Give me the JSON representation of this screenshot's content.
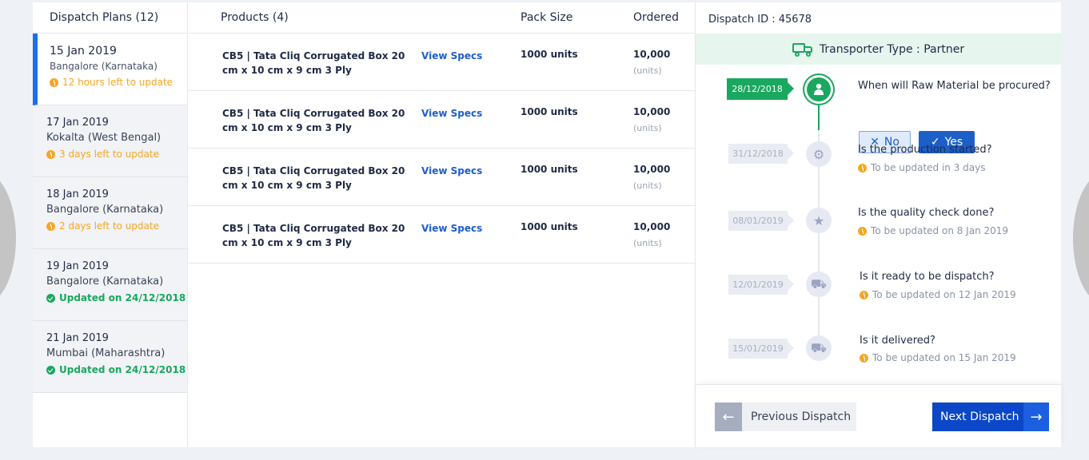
{
  "plans": {
    "header": "Dispatch Plans (12)",
    "items": [
      {
        "date": "15 Jan 2019",
        "location": "Bangalore (Karnataka)",
        "status": "12 hours left to update",
        "state": "warn"
      },
      {
        "date": "17 Jan 2019",
        "location": "Kokalta (West Bengal)",
        "status": "3 days left to update",
        "state": "warn"
      },
      {
        "date": "18 Jan 2019",
        "location": "Bangalore (Karnataka)",
        "status": "2 days left to update",
        "state": "warn"
      },
      {
        "date": "19 Jan 2019",
        "location": "Bangalore (Karnataka)",
        "status": "Updated on 24/12/2018",
        "state": "ok"
      },
      {
        "date": "21 Jan 2019",
        "location": "Mumbai (Maharashtra)",
        "status": "Updated on 24/12/2018",
        "state": "ok"
      }
    ]
  },
  "products": {
    "headers": {
      "product": "Products (4)",
      "pack": "Pack Size",
      "ordered": "Ordered"
    },
    "rows": [
      {
        "name": "CB5 | Tata Cliq Corrugated Box 20 cm x 10 cm x 9 cm 3 Ply",
        "specs": "View Specs",
        "pack": "1000 units",
        "ordered": "10,000",
        "unit": "(units)"
      },
      {
        "name": "CB5 | Tata Cliq Corrugated Box 20 cm x 10 cm x 9 cm 3 Ply",
        "specs": "View Specs",
        "pack": "1000 units",
        "ordered": "10,000",
        "unit": "(units)"
      },
      {
        "name": "CB5 | Tata Cliq Corrugated Box 20 cm x 10 cm x 9 cm 3 Ply",
        "specs": "View Specs",
        "pack": "1000 units",
        "ordered": "10,000",
        "unit": "(units)"
      },
      {
        "name": "CB5 | Tata Cliq Corrugated Box 20 cm x 10 cm x 9 cm 3 Ply",
        "specs": "View Specs",
        "pack": "1000 units",
        "ordered": "10,000",
        "unit": "(units)"
      }
    ]
  },
  "dispatch": {
    "title": "Dispatch ID : 45678",
    "transporter": "Transporter Type : Partner",
    "steps": [
      {
        "date": "28/12/2018",
        "question": "When will Raw Material be procured?",
        "icon": "person-icon"
      },
      {
        "date": "31/12/2018",
        "question": "Is the production started?",
        "status": "To be updated in 3 days",
        "icon": "gears-icon"
      },
      {
        "date": "08/01/2019",
        "question": "Is the quality check done?",
        "status": "To be updated on 8 Jan 2019",
        "icon": "star-icon"
      },
      {
        "date": "12/01/2019",
        "question": "Is it ready to be dispatch?",
        "status": "To be updated on 12 Jan 2019",
        "icon": "truck-icon"
      },
      {
        "date": "15/01/2019",
        "question": "Is it delivered?",
        "status": "To be updated on 15 Jan 2019",
        "icon": "delivery-icon"
      }
    ],
    "no_label": "No",
    "yes_label": "Yes",
    "prev_label": "Previous Dispatch",
    "next_label": "Next Dispatch"
  },
  "colors": {
    "accent": "#1d6fe8",
    "success": "#1aa75f",
    "warning": "#f5a623",
    "primary_button": "#0b47c7"
  }
}
